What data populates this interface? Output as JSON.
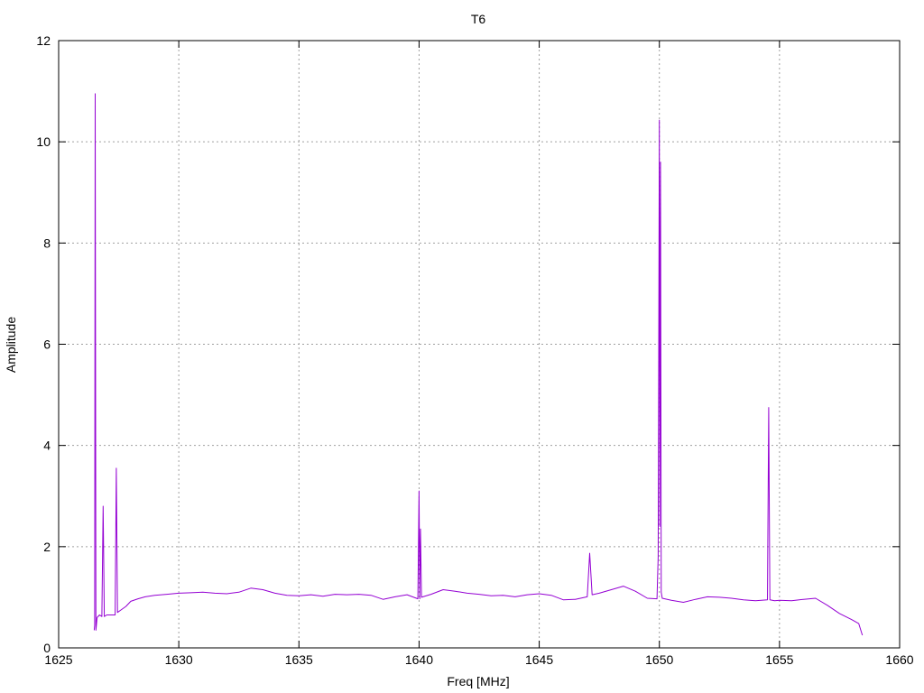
{
  "chart_data": {
    "type": "line",
    "title": "T6",
    "xlabel": "Freq [MHz]",
    "ylabel": "Amplitude",
    "xlim": [
      1625,
      1660
    ],
    "ylim": [
      0,
      12
    ],
    "x_ticks": [
      1625,
      1630,
      1635,
      1640,
      1645,
      1650,
      1655,
      1660
    ],
    "y_ticks": [
      0,
      2,
      4,
      6,
      8,
      10,
      12
    ],
    "grid": true,
    "legend": "none",
    "series": [
      {
        "color": "#9400d3",
        "x": [
          1626.48,
          1626.5,
          1626.52,
          1626.55,
          1626.6,
          1626.7,
          1626.8,
          1626.85,
          1626.9,
          1627.0,
          1627.2,
          1627.35,
          1627.4,
          1627.45,
          1627.6,
          1627.8,
          1628.0,
          1628.3,
          1628.6,
          1629.0,
          1629.5,
          1630.0,
          1630.5,
          1631.0,
          1631.5,
          1632.0,
          1632.5,
          1633.0,
          1633.5,
          1634.0,
          1634.5,
          1635.0,
          1635.5,
          1636.0,
          1636.5,
          1637.0,
          1637.5,
          1638.0,
          1638.5,
          1639.0,
          1639.5,
          1639.95,
          1640.0,
          1640.03,
          1640.06,
          1640.1,
          1640.5,
          1641.0,
          1641.5,
          1642.0,
          1642.5,
          1643.0,
          1643.5,
          1644.0,
          1644.5,
          1645.0,
          1645.5,
          1646.0,
          1646.5,
          1647.0,
          1647.1,
          1647.2,
          1647.5,
          1648.0,
          1648.5,
          1649.0,
          1649.5,
          1649.9,
          1649.95,
          1650.0,
          1650.02,
          1650.05,
          1650.08,
          1650.12,
          1650.5,
          1651.0,
          1651.5,
          1652.0,
          1652.5,
          1653.0,
          1653.5,
          1654.0,
          1654.5,
          1654.55,
          1654.6,
          1654.8,
          1655.0,
          1655.5,
          1656.0,
          1656.5,
          1657.0,
          1657.5,
          1658.0,
          1658.3,
          1658.45
        ],
        "y": [
          0.35,
          0.45,
          10.95,
          0.35,
          0.6,
          0.65,
          0.62,
          2.8,
          0.62,
          0.65,
          0.65,
          0.65,
          3.55,
          0.7,
          0.75,
          0.82,
          0.92,
          0.97,
          1.01,
          1.04,
          1.06,
          1.08,
          1.09,
          1.1,
          1.08,
          1.07,
          1.1,
          1.18,
          1.15,
          1.08,
          1.04,
          1.03,
          1.05,
          1.02,
          1.06,
          1.05,
          1.06,
          1.04,
          0.96,
          1.01,
          1.05,
          0.97,
          3.1,
          0.97,
          2.35,
          1.0,
          1.06,
          1.15,
          1.12,
          1.08,
          1.06,
          1.03,
          1.04,
          1.01,
          1.05,
          1.07,
          1.04,
          0.95,
          0.96,
          1.01,
          1.87,
          1.05,
          1.08,
          1.15,
          1.22,
          1.12,
          0.98,
          0.97,
          1.8,
          10.43,
          2.4,
          9.6,
          1.1,
          0.98,
          0.94,
          0.9,
          0.96,
          1.01,
          1.0,
          0.98,
          0.95,
          0.93,
          0.95,
          4.75,
          0.95,
          0.93,
          0.94,
          0.93,
          0.96,
          0.98,
          0.84,
          0.68,
          0.56,
          0.48,
          0.25
        ]
      }
    ]
  }
}
